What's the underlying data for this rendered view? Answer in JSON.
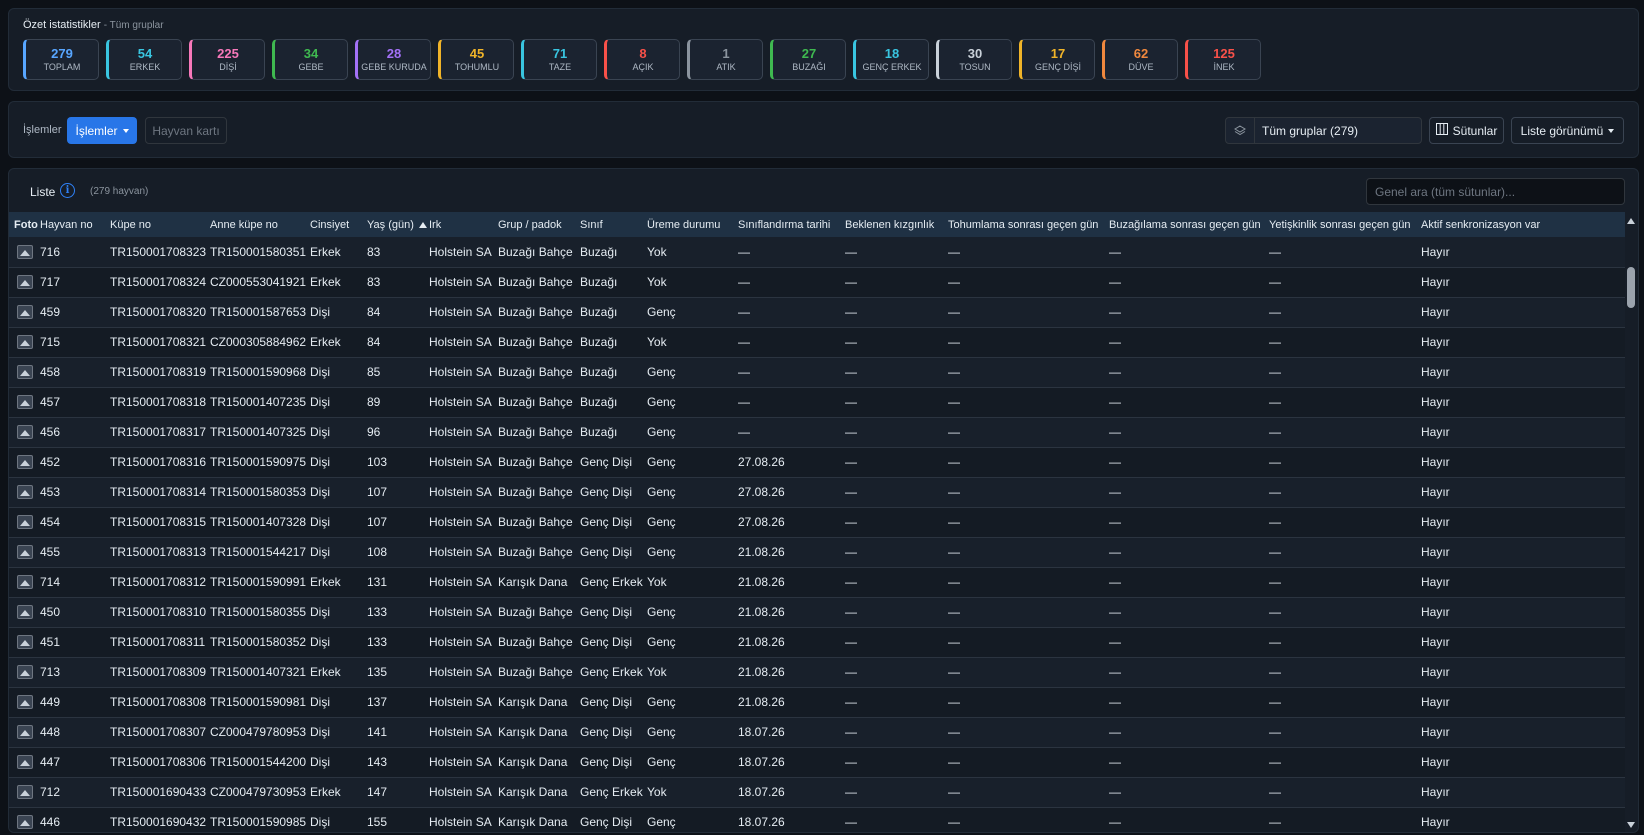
{
  "summary": {
    "title": "Özet istatistikler",
    "subtitle": "- Tüm gruplar",
    "cards": [
      {
        "value": "279",
        "label": "TOPLAM",
        "color": "#58a6ff"
      },
      {
        "value": "54",
        "label": "ERKEK",
        "color": "#39c5e0"
      },
      {
        "value": "225",
        "label": "DİŞİ",
        "color": "#f778ba"
      },
      {
        "value": "34",
        "label": "GEBE",
        "color": "#3fb950"
      },
      {
        "value": "28",
        "label": "GEBE KURUDA",
        "color": "#a371f7"
      },
      {
        "value": "45",
        "label": "TOHUMLU",
        "color": "#f0b429"
      },
      {
        "value": "71",
        "label": "TAZE",
        "color": "#39c5e0"
      },
      {
        "value": "8",
        "label": "AÇIK",
        "color": "#f85149"
      },
      {
        "value": "1",
        "label": "ATIK",
        "color": "#8b949e"
      },
      {
        "value": "27",
        "label": "BUZAĞI",
        "color": "#3fb950"
      },
      {
        "value": "18",
        "label": "GENÇ ERKEK",
        "color": "#39c5e0"
      },
      {
        "value": "30",
        "label": "TOSUN",
        "color": "#c9d1d9"
      },
      {
        "value": "17",
        "label": "GENÇ DİŞİ",
        "color": "#f0b429"
      },
      {
        "value": "62",
        "label": "DÜVE",
        "color": "#f0883e"
      },
      {
        "value": "125",
        "label": "İNEK",
        "color": "#f85149"
      }
    ]
  },
  "toolbar": {
    "label": "İşlemler",
    "actions_button": "İşlemler",
    "animal_card_button": "Hayvan kartı",
    "group_select": "Tüm gruplar (279)",
    "columns_button": "Sütunlar",
    "view_button": "Liste görünümü"
  },
  "list": {
    "title": "Liste",
    "count": "(279 hayvan)",
    "search_placeholder": "Genel ara (tüm sütunlar)...",
    "columns": [
      "Foto",
      "Hayvan no",
      "Küpe no",
      "Anne küpe no",
      "Cinsiyet",
      "Yaş (gün)",
      "Irk",
      "Grup / padok",
      "Sınıf",
      "Üreme durumu",
      "Sınıflandırma tarihi",
      "Beklenen kızgınlık",
      "Tohumlama sonrası geçen gün",
      "Buzağılama sonrası geçen gün",
      "Yetişkinlik sonrası geçen gün",
      "Aktif senkronizasyon var"
    ],
    "rows": [
      [
        "716",
        "TR150001708323",
        "TR150001580351",
        "Erkek",
        "83",
        "Holstein SA",
        "Buzağı Bahçe",
        "Buzağı",
        "Yok",
        "—",
        "—",
        "—",
        "—",
        "—",
        "Hayır"
      ],
      [
        "717",
        "TR150001708324",
        "CZ000553041921",
        "Erkek",
        "83",
        "Holstein SA",
        "Buzağı Bahçe",
        "Buzağı",
        "Yok",
        "—",
        "—",
        "—",
        "—",
        "—",
        "Hayır"
      ],
      [
        "459",
        "TR150001708320",
        "TR150001587653",
        "Dişi",
        "84",
        "Holstein SA",
        "Buzağı Bahçe",
        "Buzağı",
        "Genç",
        "—",
        "—",
        "—",
        "—",
        "—",
        "Hayır"
      ],
      [
        "715",
        "TR150001708321",
        "CZ000305884962",
        "Erkek",
        "84",
        "Holstein SA",
        "Buzağı Bahçe",
        "Buzağı",
        "Yok",
        "—",
        "—",
        "—",
        "—",
        "—",
        "Hayır"
      ],
      [
        "458",
        "TR150001708319",
        "TR150001590968",
        "Dişi",
        "85",
        "Holstein SA",
        "Buzağı Bahçe",
        "Buzağı",
        "Genç",
        "—",
        "—",
        "—",
        "—",
        "—",
        "Hayır"
      ],
      [
        "457",
        "TR150001708318",
        "TR150001407235",
        "Dişi",
        "89",
        "Holstein SA",
        "Buzağı Bahçe",
        "Buzağı",
        "Genç",
        "—",
        "—",
        "—",
        "—",
        "—",
        "Hayır"
      ],
      [
        "456",
        "TR150001708317",
        "TR150001407325",
        "Dişi",
        "96",
        "Holstein SA",
        "Buzağı Bahçe",
        "Buzağı",
        "Genç",
        "—",
        "—",
        "—",
        "—",
        "—",
        "Hayır"
      ],
      [
        "452",
        "TR150001708316",
        "TR150001590975",
        "Dişi",
        "103",
        "Holstein SA",
        "Buzağı Bahçe",
        "Genç Dişi",
        "Genç",
        "27.08.26",
        "—",
        "—",
        "—",
        "—",
        "Hayır"
      ],
      [
        "453",
        "TR150001708314",
        "TR150001580353",
        "Dişi",
        "107",
        "Holstein SA",
        "Buzağı Bahçe",
        "Genç Dişi",
        "Genç",
        "27.08.26",
        "—",
        "—",
        "—",
        "—",
        "Hayır"
      ],
      [
        "454",
        "TR150001708315",
        "TR150001407328",
        "Dişi",
        "107",
        "Holstein SA",
        "Buzağı Bahçe",
        "Genç Dişi",
        "Genç",
        "27.08.26",
        "—",
        "—",
        "—",
        "—",
        "Hayır"
      ],
      [
        "455",
        "TR150001708313",
        "TR150001544217",
        "Dişi",
        "108",
        "Holstein SA",
        "Buzağı Bahçe",
        "Genç Dişi",
        "Genç",
        "21.08.26",
        "—",
        "—",
        "—",
        "—",
        "Hayır"
      ],
      [
        "714",
        "TR150001708312",
        "TR150001590991",
        "Erkek",
        "131",
        "Holstein SA",
        "Karışık Dana",
        "Genç Erkek",
        "Yok",
        "21.08.26",
        "—",
        "—",
        "—",
        "—",
        "Hayır"
      ],
      [
        "450",
        "TR150001708310",
        "TR150001580355",
        "Dişi",
        "133",
        "Holstein SA",
        "Buzağı Bahçe",
        "Genç Dişi",
        "Genç",
        "21.08.26",
        "—",
        "—",
        "—",
        "—",
        "Hayır"
      ],
      [
        "451",
        "TR150001708311",
        "TR150001580352",
        "Dişi",
        "133",
        "Holstein SA",
        "Buzağı Bahçe",
        "Genç Dişi",
        "Genç",
        "21.08.26",
        "—",
        "—",
        "—",
        "—",
        "Hayır"
      ],
      [
        "713",
        "TR150001708309",
        "TR150001407321",
        "Erkek",
        "135",
        "Holstein SA",
        "Buzağı Bahçe",
        "Genç Erkek",
        "Yok",
        "21.08.26",
        "—",
        "—",
        "—",
        "—",
        "Hayır"
      ],
      [
        "449",
        "TR150001708308",
        "TR150001590981",
        "Dişi",
        "137",
        "Holstein SA",
        "Karışık Dana",
        "Genç Dişi",
        "Genç",
        "21.08.26",
        "—",
        "—",
        "—",
        "—",
        "Hayır"
      ],
      [
        "448",
        "TR150001708307",
        "CZ000479780953",
        "Dişi",
        "141",
        "Holstein SA",
        "Karışık Dana",
        "Genç Dişi",
        "Genç",
        "18.07.26",
        "—",
        "—",
        "—",
        "—",
        "Hayır"
      ],
      [
        "447",
        "TR150001708306",
        "TR150001544200",
        "Dişi",
        "143",
        "Holstein SA",
        "Karışık Dana",
        "Genç Dişi",
        "Genç",
        "18.07.26",
        "—",
        "—",
        "—",
        "—",
        "Hayır"
      ],
      [
        "712",
        "TR150001690433",
        "CZ000479730953",
        "Erkek",
        "147",
        "Holstein SA",
        "Karışık Dana",
        "Genç Erkek",
        "Yok",
        "18.07.26",
        "—",
        "—",
        "—",
        "—",
        "Hayır"
      ],
      [
        "446",
        "TR150001690432",
        "TR150001590985",
        "Dişi",
        "155",
        "Holstein SA",
        "Karışık Dana",
        "Genç Dişi",
        "Genç",
        "18.07.26",
        "—",
        "—",
        "—",
        "—",
        "Hayır"
      ]
    ]
  }
}
